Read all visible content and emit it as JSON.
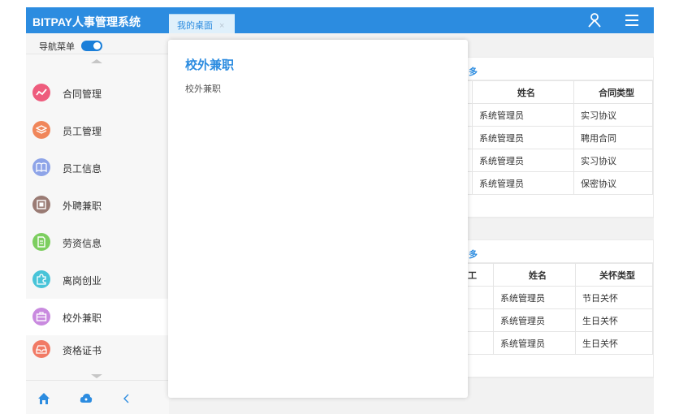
{
  "app": {
    "brand": "BITPAY人事管理系统"
  },
  "tabs": [
    {
      "label": "我的桌面",
      "close": "×"
    }
  ],
  "colors": {
    "primary": "#2c8ce0",
    "toggle": "#1b7fd9"
  },
  "icons": {
    "user": "user-icon",
    "menu": "menu-icon"
  },
  "sidebar": {
    "nav_label": "导航菜单",
    "toggle_on": true,
    "items": [
      {
        "label": "合同管理",
        "icon": "trend-icon",
        "color": "#ee5c7d"
      },
      {
        "label": "员工管理",
        "icon": "layers-icon",
        "color": "#f0865a"
      },
      {
        "label": "员工信息",
        "icon": "book-icon",
        "color": "#8ea4e8"
      },
      {
        "label": "外聘兼职",
        "icon": "building-icon",
        "color": "#9a7b74"
      },
      {
        "label": "劳资信息",
        "icon": "document-icon",
        "color": "#7cce5f"
      },
      {
        "label": "离岗创业",
        "icon": "puzzle-icon",
        "color": "#48c4d8"
      },
      {
        "label": "校外兼职",
        "icon": "briefcase-icon",
        "color": "#c98adf",
        "active": true
      },
      {
        "label": "资格证书",
        "icon": "inbox-icon",
        "color": "#f17a65"
      }
    ],
    "bottom_icons": [
      "home-icon",
      "cloud-icon",
      "chevron-left-icon"
    ]
  },
  "panel_contract": {
    "more": "多",
    "headers": [
      "姓名",
      "合同类型"
    ],
    "rows": [
      [
        "系统管理员",
        "实习协议"
      ],
      [
        "系统管理员",
        "聘用合同"
      ],
      [
        "系统管理员",
        "实习协议"
      ],
      [
        "系统管理员",
        "保密协议"
      ]
    ]
  },
  "panel_care": {
    "more": "多",
    "headers": [
      "工",
      "姓名",
      "关怀类型"
    ],
    "rows": [
      [
        "",
        "系统管理员",
        "节日关怀"
      ],
      [
        "",
        "系统管理员",
        "生日关怀"
      ],
      [
        "",
        "系统管理员",
        "生日关怀"
      ]
    ]
  },
  "modal": {
    "title": "校外兼职",
    "body": "校外兼职"
  }
}
